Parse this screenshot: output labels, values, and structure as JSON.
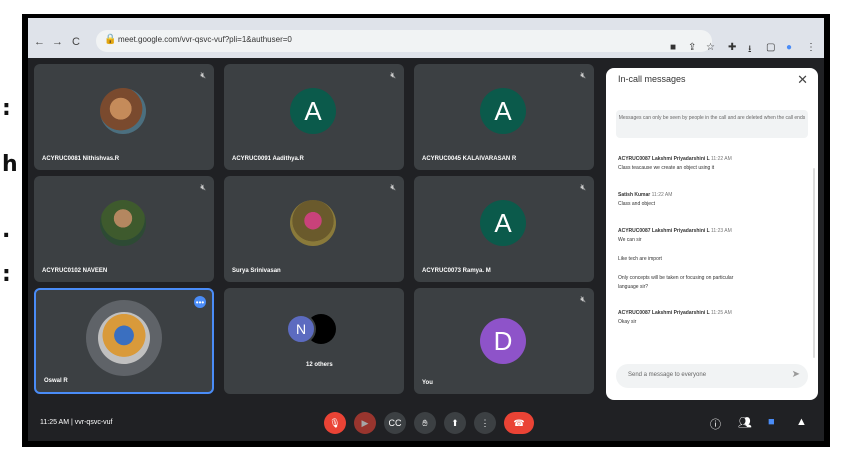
{
  "left_glyphs": [
    ":",
    "h",
    ".",
    ":"
  ],
  "browser": {
    "nav_back": "←",
    "nav_forward": "→",
    "nav_reload": "C",
    "url": "meet.google.com/vvr-qsvc-vuf?pli=1&authuser=0"
  },
  "participants": [
    {
      "name": "ACYRUC0081 Nithishvas.R"
    },
    {
      "name": "ACYRUC0091 Aadithya.R",
      "letter": "A"
    },
    {
      "name": "ACYRUC0045 KALAIVARASAN R",
      "letter": "A"
    },
    {
      "name": "ACYRUC0102 NAVEEN"
    },
    {
      "name": "Surya Srinivasan"
    },
    {
      "name": "ACYRUC0073 Ramya. M",
      "letter": "A"
    },
    {
      "name": "Oswal R"
    },
    {
      "name": "12 others",
      "letters": [
        "N"
      ]
    },
    {
      "name": "You",
      "letter": "D"
    }
  ],
  "chat": {
    "title": "In-call messages",
    "notice": "Messages can only be seen by people in the call and are deleted when the call ends",
    "messages": [
      {
        "sender": "ACYRUC0087 Lakshmi Priyadarshini L",
        "time": "11:22 AM",
        "text": "Class teacause we create an object using it"
      },
      {
        "sender": "Satish Kumar",
        "time": "11:22 AM",
        "text": "Class and object"
      },
      {
        "sender": "ACYRUC0087 Lakshmi Priyadarshini L",
        "time": "11:23 AM",
        "text": "We can sir"
      },
      {
        "text": "Like tech are import"
      },
      {
        "text": "Only concepts will be taken or focusing on particular"
      },
      {
        "text": "language sir?"
      },
      {
        "sender": "ACYRUC0087 Lakshmi Priyadarshini L",
        "time": "11:25 AM",
        "text": "Okay sir"
      }
    ],
    "input_placeholder": "Send a message to everyone",
    "send_icon": "send-icon"
  },
  "bottom": {
    "clock": "11:25 AM  |  vvr-qsvc-vuf"
  },
  "colors": {
    "tile_bg": "#3c4043",
    "meet_bg": "#202124",
    "teal_avatar": "#0b5a4b",
    "purple_avatar": "#8e53c9",
    "indigo_avatar": "#5c6bc0",
    "red": "#ea4335",
    "active_border": "#4a8cf7"
  }
}
